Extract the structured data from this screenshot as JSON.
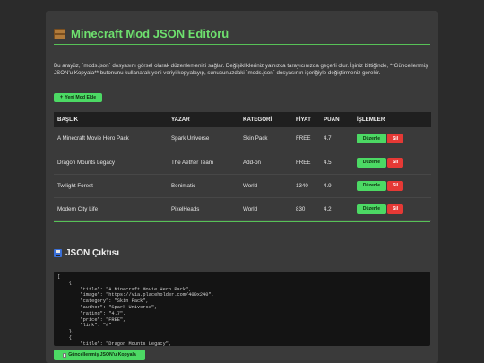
{
  "header": {
    "title": "Minecraft Mod JSON Editörü",
    "icon": "package-icon"
  },
  "description": "Bu arayüz, `mods.json` dosyasını görsel olarak düzenlemenizi sağlar. Değişiklikleriniz yalnızca tarayıcınızda geçerli olur. İşiniz bittiğinde, **Güncellenmiş JSON'u Kopyala** butonunu kullanarak yeni veriyi kopyalayıp, sunucunuzdaki `mods.json` dosyasının içeriğiyle değiştirmeniz gerekir.",
  "add_button": {
    "icon": "+",
    "label": "Yeni Mod Ekle"
  },
  "table": {
    "headers": [
      "BAŞLIK",
      "YAZAR",
      "KATEGORİ",
      "FİYAT",
      "PUAN",
      "İŞLEMLER"
    ],
    "rows": [
      {
        "title": "A Minecraft Movie Hero Pack",
        "author": "Spark Universe",
        "category": "Skin Pack",
        "price": "FREE",
        "rating": "4.7",
        "edit": "Düzenle",
        "delete": "Sil"
      },
      {
        "title": "Dragon Mounts Legacy",
        "author": "The Aether Team",
        "category": "Add-on",
        "price": "FREE",
        "rating": "4.5",
        "edit": "Düzenle",
        "delete": "Sil"
      },
      {
        "title": "Twilight Forest",
        "author": "Benimatic",
        "category": "World",
        "price": "1340",
        "rating": "4.9",
        "edit": "Düzenle",
        "delete": "Sil"
      },
      {
        "title": "Modern City Life",
        "author": "PixelHeads",
        "category": "World",
        "price": "830",
        "rating": "4.2",
        "edit": "Düzenle",
        "delete": "Sil"
      }
    ]
  },
  "json_section": {
    "title": "JSON Çıktısı",
    "icon": "floppy-disk-icon",
    "code": "[\n    {\n        \"title\": \"A Minecraft Movie Hero Pack\",\n        \"image\": \"https://via.placeholder.com/400x240\",\n        \"category\": \"Skin Pack\",\n        \"author\": \"Spark Universe\",\n        \"rating\": \"4.7\",\n        \"price\": \"FREE\",\n        \"link\": \"#\"\n    },\n    {\n        \"title\": \"Dragon Mounts Legacy\",\n        \"image\": \"https://media.forgecdn.net/avatars/thumbnails/141/363/400/400/636878540049473378.png\","
  },
  "copy_button": {
    "icon": "clipboard-icon",
    "label": "Güncellenmiş JSON'u Kopyala"
  },
  "colors": {
    "accent": "#57c257",
    "button_green": "#4cd964",
    "button_red": "#e53935",
    "panel": "#3a3a3a",
    "code_bg": "#141414"
  }
}
